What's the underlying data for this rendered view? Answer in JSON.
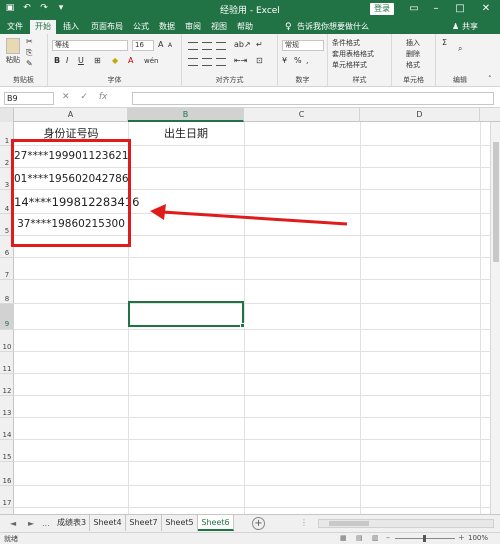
{
  "titlebar": {
    "title": "经验用 - Excel",
    "login": "登录",
    "qat": {
      "save_icon": "save-icon",
      "undo_icon": "undo-icon",
      "redo_icon": "redo-icon"
    }
  },
  "tabs": [
    "文件",
    "开始",
    "插入",
    "页面布局",
    "公式",
    "数据",
    "审阅",
    "视图",
    "帮助"
  ],
  "active_tab": "开始",
  "tell_me": "告诉我你想要做什么",
  "share": "共享",
  "ribbon": {
    "clipboard": {
      "paste": "粘贴",
      "label": "剪贴板"
    },
    "font": {
      "name": "等线",
      "size": "16",
      "label": "字体",
      "bold": "B",
      "italic": "I",
      "underline": "U",
      "grow": "A",
      "shrink": "A",
      "font_color_char": "A",
      "phonetic": "wén"
    },
    "alignment": {
      "label": "对齐方式"
    },
    "number": {
      "format": "常规",
      "label": "数字",
      "percent": "%",
      "comma": ",",
      "currency": "¥"
    },
    "styles": {
      "conditional": "条件格式",
      "table": "套用表格格式",
      "cell_styles": "单元格样式",
      "label": "样式"
    },
    "cells": {
      "insert": "插入",
      "delete": "删除",
      "format": "格式",
      "label": "单元格"
    },
    "editing": {
      "label": "编辑",
      "sum": "Σ"
    }
  },
  "formula_bar": {
    "name_box": "B9",
    "cancel": "✕",
    "confirm": "✓",
    "fx": "fx",
    "value": ""
  },
  "grid": {
    "columns": [
      "A",
      "B",
      "C",
      "D"
    ],
    "selected_column": "B",
    "rows": [
      "1",
      "2",
      "3",
      "4",
      "5",
      "6",
      "7",
      "8",
      "9",
      "10",
      "11",
      "12",
      "13",
      "14",
      "15",
      "16",
      "17"
    ],
    "selected_row": "9",
    "cells": {
      "A1": "身份证号码",
      "B1": "出生日期",
      "A2": "27****199901123621",
      "A3": "01****195602042786",
      "A4": "14****199812283416",
      "A5": "37****19860215300"
    }
  },
  "annotation": {
    "box_color": "#e01b1b",
    "arrow_color": "#e01b1b"
  },
  "sheets": {
    "nav_prev": "◄",
    "nav_next": "►",
    "more": "...",
    "items": [
      "成绩表3",
      "Sheet4",
      "Sheet7",
      "Sheet5",
      "Sheet6"
    ],
    "active": "Sheet6",
    "add": "+"
  },
  "status": {
    "ready": "就绪",
    "zoom": "100%"
  },
  "colors": {
    "brand": "#217346",
    "ribbon_bg": "#f3f3f3"
  }
}
